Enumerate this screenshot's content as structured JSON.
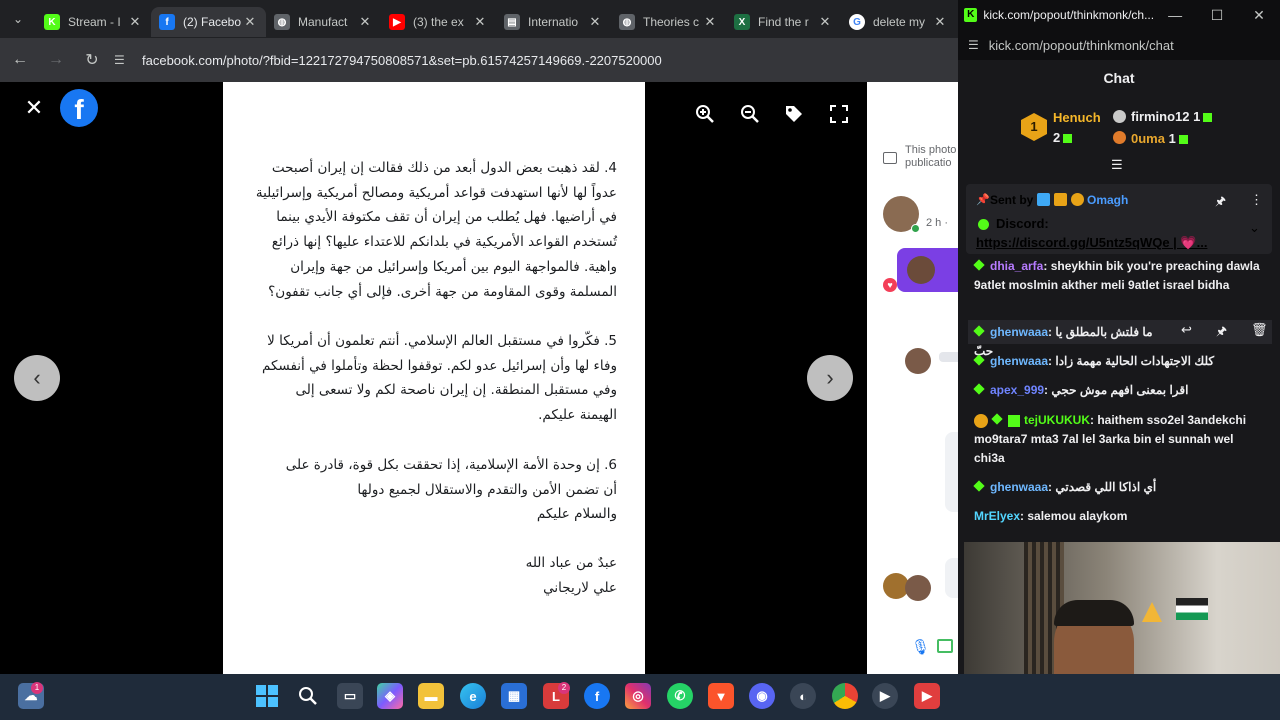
{
  "browser": {
    "tabs": [
      {
        "title": "Stream - I",
        "favicon": "kick-icon",
        "color": "#53fc18",
        "letter": "K"
      },
      {
        "title": "(2) Facebo",
        "favicon": "facebook-icon",
        "color": "#1877f2",
        "letter": "f",
        "active": true
      },
      {
        "title": "Manufact",
        "favicon": "globe-icon",
        "color": "#5f6368",
        "letter": "◍"
      },
      {
        "title": "(3) the ex",
        "favicon": "youtube-icon",
        "color": "#ff0000",
        "letter": "▶"
      },
      {
        "title": "Internatio",
        "favicon": "document-icon",
        "color": "#5f6368",
        "letter": "▤"
      },
      {
        "title": "Theories c",
        "favicon": "globe-icon",
        "color": "#5f6368",
        "letter": "◍"
      },
      {
        "title": "Find the r",
        "favicon": "excel-icon",
        "color": "#1d6f42",
        "letter": "X"
      },
      {
        "title": "delete my",
        "favicon": "google-icon",
        "color": "#ffffff",
        "letter": "G"
      }
    ],
    "url": "facebook.com/photo/?fbid=122172794750808571&set=pb.61574257149669.-2207520000"
  },
  "photo": {
    "para4": "4. لقد ذهبت بعض الدول أبعد من ذلك فقالت إن إيران أصبحت عدواً لها لأنها استهدفت قواعد أمريكية ومصالح أمريكية وإسرائيلية في أراضيها. فهل يُطلب من إيران أن تقف مكتوفة الأيدي بينما تُستخدم القواعد الأمريكية في بلدانكم للاعتداء عليها؟ إنها ذرائع واهية. فالمواجهة اليوم بين أمريكا وإسرائيل من جهة وإيران المسلمة وقوى المقاومة من جهة أخرى. فإلى أي جانب تقفون؟",
    "para5": "5. فكّروا في مستقبل العالم الإسلامي. أنتم تعلمون أن أمريكا لا وفاء لها وأن إسرائيل عدو لكم. توقفوا لحظة وتأملوا في أنفسكم وفي مستقبل المنطقة. إن إيران ناصحة لكم ولا تسعى إلى الهيمنة عليكم.",
    "para6": "6. إن وحدة الأمة الإسلامية، إذا تحققت بكل قوة، قادرة على أن تضمن الأمن والتقدم والاستقلال لجميع دولها",
    "closing": "والسلام عليكم",
    "sign1": "عبدٌ من عباد الله",
    "sign2": "علي لاريجاني"
  },
  "side": {
    "notice": "This photo publicatio",
    "time": "2 h ·"
  },
  "chat": {
    "window_title": "kick.com/popout/thinkmonk/ch...",
    "address": "kick.com/popout/thinkmonk/chat",
    "header": "Chat",
    "leaders": [
      {
        "rank": "1",
        "name": "Henuch",
        "count": "2"
      },
      {
        "name": "firmino12",
        "count": "1"
      },
      {
        "name": "0uma",
        "count": "1"
      }
    ],
    "pinned": {
      "sent_by": "Sent by",
      "user": "Omagh",
      "title": "Discord:",
      "link": "https://discord.gg/U5ntz5qWQe | 💗..."
    },
    "messages": [
      {
        "user": "dhia_arfa",
        "color": "#b77bff",
        "text": "sheykhin bik you're preaching dawla 9atlet moslmin akther meli 9atlet israel bidha"
      },
      {
        "user": "ghenwaaa",
        "color": "#6fb8ff",
        "text": "ما فلتش بالمطلق يا حبّ"
      },
      {
        "user": "ghenwaaa",
        "color": "#6fb8ff",
        "text": "كلك الاجتهادات الحالية مهمة زادا"
      },
      {
        "user": "apex_999",
        "color": "#6f84ff",
        "text": "اقرا بمعنى افهم موش حجي"
      },
      {
        "user": "tejUKUKUK",
        "color": "#53fc18",
        "text": "haithem sso2el 3andekchi mo9tara7 mta3 7al lel 3arka bin el sunnah wel chi3a"
      },
      {
        "user": "ghenwaaa",
        "color": "#6fb8ff",
        "text": "أي اذاكا اللي قصدتي"
      },
      {
        "user": "MrElyex",
        "color": "#53d6ff",
        "text": "salemou alaykom"
      }
    ]
  },
  "taskbar": {
    "badge_weather": "1",
    "badge_m": "2"
  }
}
